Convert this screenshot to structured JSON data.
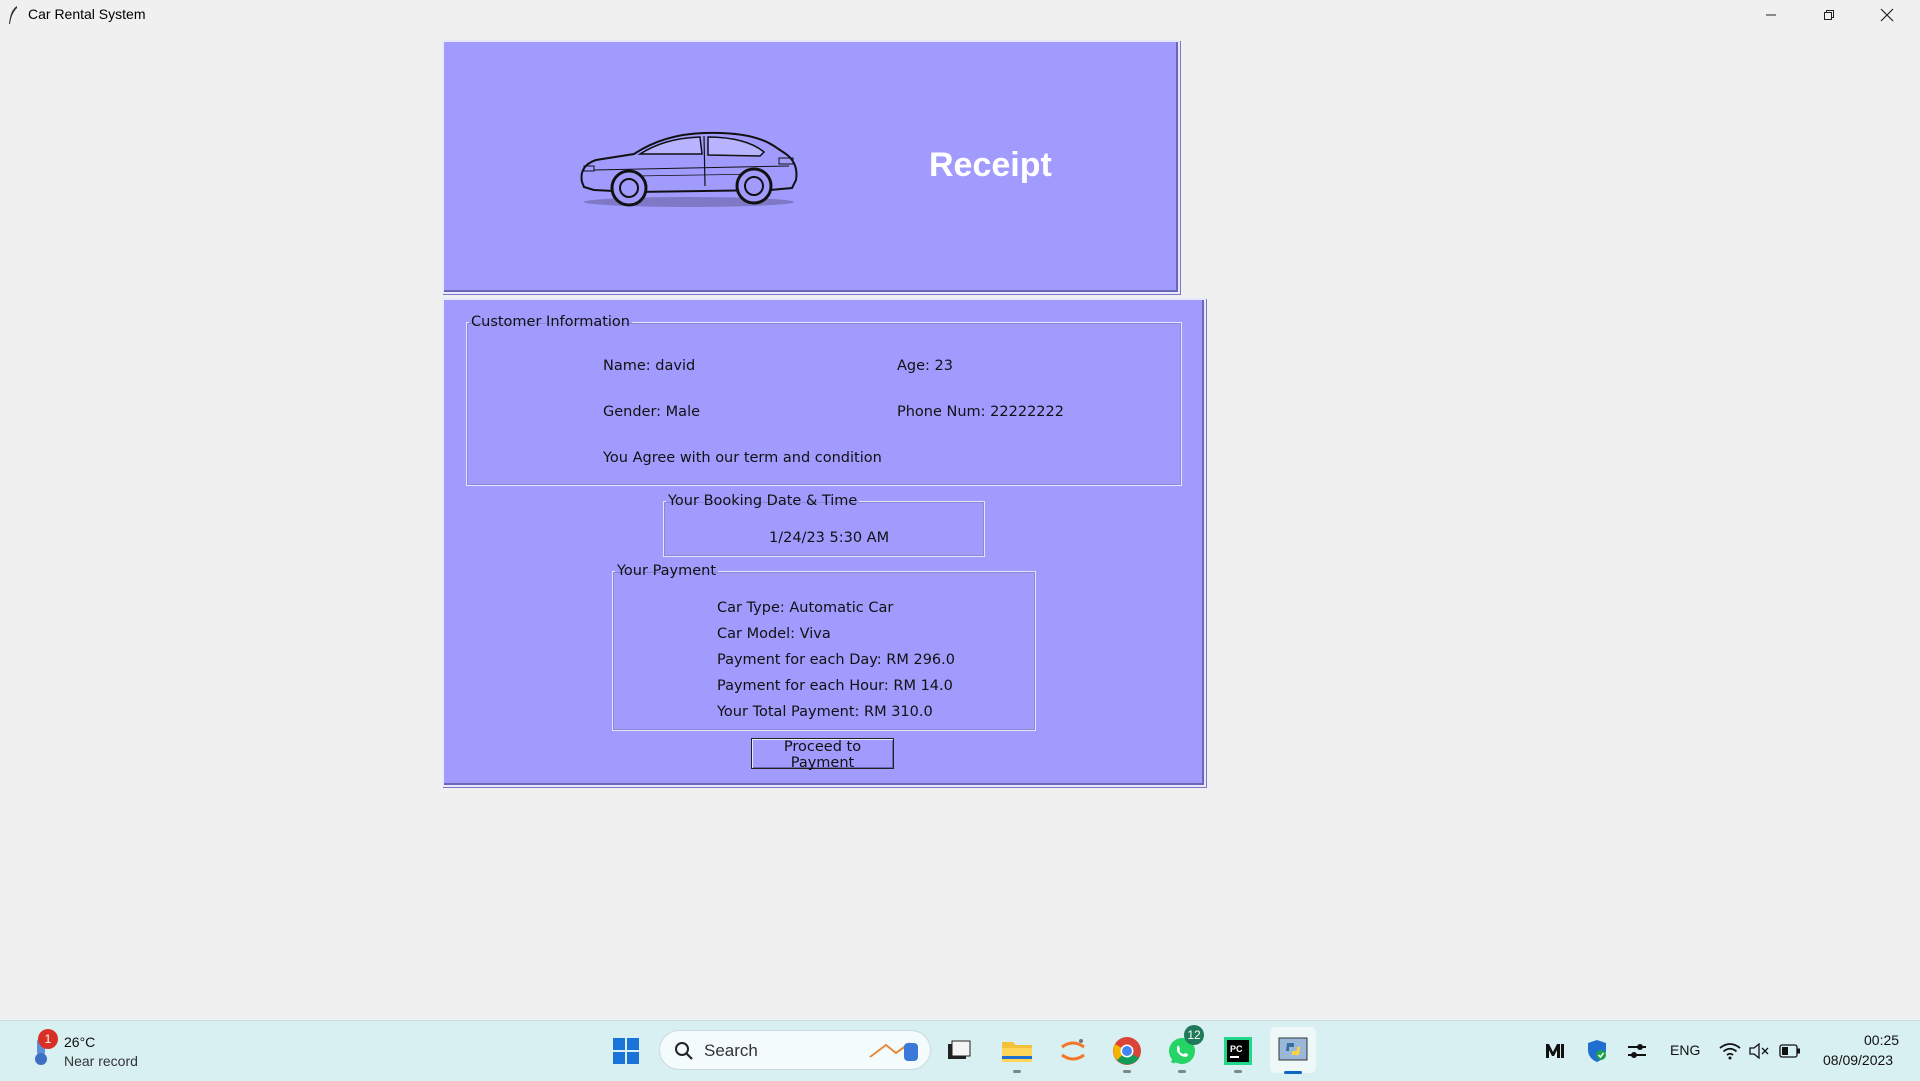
{
  "window": {
    "title": "Car Rental System"
  },
  "header": {
    "title": "Receipt"
  },
  "customer": {
    "legend": "Customer Information",
    "name": "Name: david",
    "age": "Age: 23",
    "gender": "Gender: Male",
    "phone": "Phone Num: 22222222",
    "agree": "You Agree with our term and condition"
  },
  "booking": {
    "legend": "Your Booking Date & Time",
    "datetime": "1/24/23  5:30 AM"
  },
  "payment": {
    "legend": "Your Payment",
    "car_type": "Car Type: Automatic Car",
    "car_model": "Car Model: Viva",
    "per_day": "Payment for each Day: RM 296.0",
    "per_hour": "Payment for each Hour: RM 14.0",
    "total": "Your Total Payment: RM 310.0"
  },
  "actions": {
    "proceed_label": "Proceed to Payment"
  },
  "taskbar": {
    "weather_temp": "26°C",
    "weather_desc": "Near record",
    "weather_badge": "1",
    "search_label": "Search",
    "whatsapp_badge": "12",
    "language": "ENG",
    "time": "00:25",
    "date": "08/09/2023"
  },
  "colors": {
    "frame_bg": "#a29bfe",
    "window_bg": "#f0f0f0",
    "taskbar_bg": "#d8f0f2"
  }
}
